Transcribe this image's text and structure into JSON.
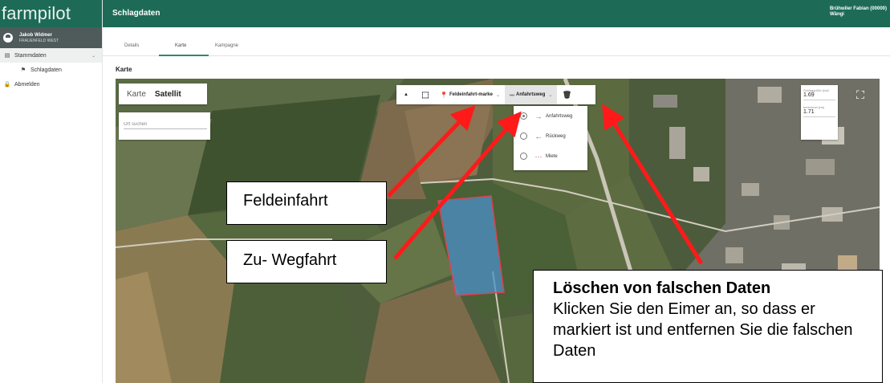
{
  "app": {
    "logo": "farmpilot",
    "page_title": "Schlagdaten"
  },
  "user": {
    "name": "Jakob Widmer",
    "org": "FRAUENFELD WEST"
  },
  "account": {
    "line1": "Brühwiler Fabian (00000)",
    "line2": "Wängi"
  },
  "sidebar": {
    "items": [
      {
        "label": "Stammdaten",
        "icon": "folder-icon"
      },
      {
        "label": "Schlagdaten",
        "icon": "flag-icon"
      },
      {
        "label": "Abmelden",
        "icon": "lock-icon"
      }
    ]
  },
  "tabs": [
    {
      "label": "Details"
    },
    {
      "label": "Karte",
      "active": true
    },
    {
      "label": "Kampagne"
    }
  ],
  "section": {
    "title": "Karte"
  },
  "map": {
    "type_karte": "Karte",
    "type_satellit": "Satellit",
    "search_placeholder": "Ort suchen",
    "toolbar": {
      "feldeinfahrt": "Feldeinfahrt-marke",
      "anfahrtsweg": "Anfahrtsweg"
    },
    "dropdown": [
      {
        "label": "Anfahrtsweg",
        "icon": "arrow-right-icon",
        "color": "#2e9c5c",
        "selected": true
      },
      {
        "label": "Rückweg",
        "icon": "arrow-left-icon",
        "color": "#2f6fd6",
        "selected": false
      },
      {
        "label": "Miete",
        "icon": "dots-icon",
        "color": "#c0392b",
        "selected": false
      }
    ],
    "area_label": "Schlaggröße (ha)*",
    "area_value": "1.69",
    "area2_label": "berechnet (ha)",
    "area2_value": "1.71"
  },
  "callouts": {
    "feldeinfahrt": "Feldeinfahrt",
    "wegfahrt": "Zu- Wegfahrt",
    "delete_title": "Löschen von falschen Daten",
    "delete_body": "Klicken Sie den Eimer an, so dass er markiert ist und entfernen Sie die falschen Daten"
  },
  "colors": {
    "brand": "#1d6b57",
    "arrow": "#ff1a1a",
    "field_polygon": "#4b8fc9"
  }
}
